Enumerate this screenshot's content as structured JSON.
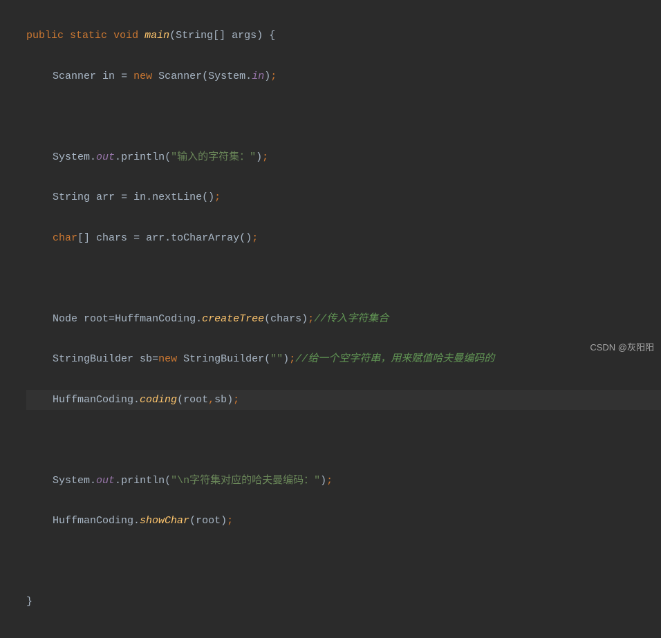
{
  "code": {
    "l1": {
      "public": "public",
      "static": "static",
      "void": "void",
      "main": "main",
      "string": "String",
      "brackets": "[]",
      "args": "args",
      "lparen": "(",
      "rparen": ")",
      "lbrace": "{"
    },
    "l2": {
      "scanner": "Scanner",
      "in": "in",
      "eq": "=",
      "new": "new",
      "scanner2": "Scanner",
      "lparen": "(",
      "system": "System",
      "dot": ".",
      "field": "in",
      "rparen": ")",
      "semi": ";"
    },
    "l4": {
      "system": "System",
      "dot": ".",
      "out": "out",
      "dot2": ".",
      "println": "println",
      "lparen": "(",
      "str": "\"输入的字符集：\"",
      "rparen": ")",
      "semi": ";"
    },
    "l5": {
      "string": "String",
      "arr": "arr",
      "eq": "=",
      "in": "in",
      "dot": ".",
      "nextLine": "nextLine",
      "lparen": "(",
      "rparen": ")",
      "semi": ";"
    },
    "l6": {
      "char": "char",
      "brackets": "[]",
      "chars": "chars",
      "eq": "=",
      "arr": "arr",
      "dot": ".",
      "toCharArray": "toCharArray",
      "lparen": "(",
      "rparen": ")",
      "semi": ";"
    },
    "l8": {
      "node": "Node",
      "root": "root",
      "eq": "=",
      "huffman": "HuffmanCoding",
      "dot": ".",
      "createTree": "createTree",
      "lparen": "(",
      "chars": "chars",
      "rparen": ")",
      "semi": ";",
      "comment": "//传入字符集合"
    },
    "l9": {
      "sb_type": "StringBuilder",
      "sb": "sb",
      "eq": "=",
      "new": "new",
      "sb_type2": "StringBuilder",
      "lparen": "(",
      "str": "\"\"",
      "rparen": ")",
      "semi": ";",
      "comment": "//给一个空字符串，用来赋值哈夫曼编码的"
    },
    "l10": {
      "huffman": "HuffmanCoding",
      "dot": ".",
      "coding": "coding",
      "lparen": "(",
      "root": "root",
      "comma": ",",
      "sb": "sb",
      "rparen": ")",
      "semi": ";"
    },
    "l12": {
      "system": "System",
      "dot": ".",
      "out": "out",
      "dot2": ".",
      "println": "println",
      "lparen": "(",
      "str": "\"\\n字符集对应的哈夫曼编码：\"",
      "rparen": ")",
      "semi": ";"
    },
    "l13": {
      "huffman": "HuffmanCoding",
      "dot": ".",
      "showChar": "showChar",
      "lparen": "(",
      "root": "root",
      "rparen": ")",
      "semi": ";"
    },
    "l15": {
      "rbrace": "}"
    }
  },
  "watermark": "CSDN @灰阳阳"
}
